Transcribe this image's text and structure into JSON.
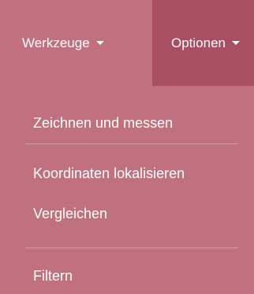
{
  "nav": {
    "tools_label": "Werkzeuge",
    "options_label": "Optionen"
  },
  "dropdown": {
    "items": [
      {
        "label": "Zeichnen und messen"
      },
      {
        "label": "Koordinaten lokalisieren"
      },
      {
        "label": "Vergleichen"
      },
      {
        "label": "Filtern"
      }
    ]
  },
  "colors": {
    "menu_bg": "#c0707f",
    "active_bg": "#a84f63",
    "divider": "#d99aa6",
    "text": "#ffffff"
  },
  "icons": {
    "dropdown_caret": "chevron-down-icon"
  }
}
